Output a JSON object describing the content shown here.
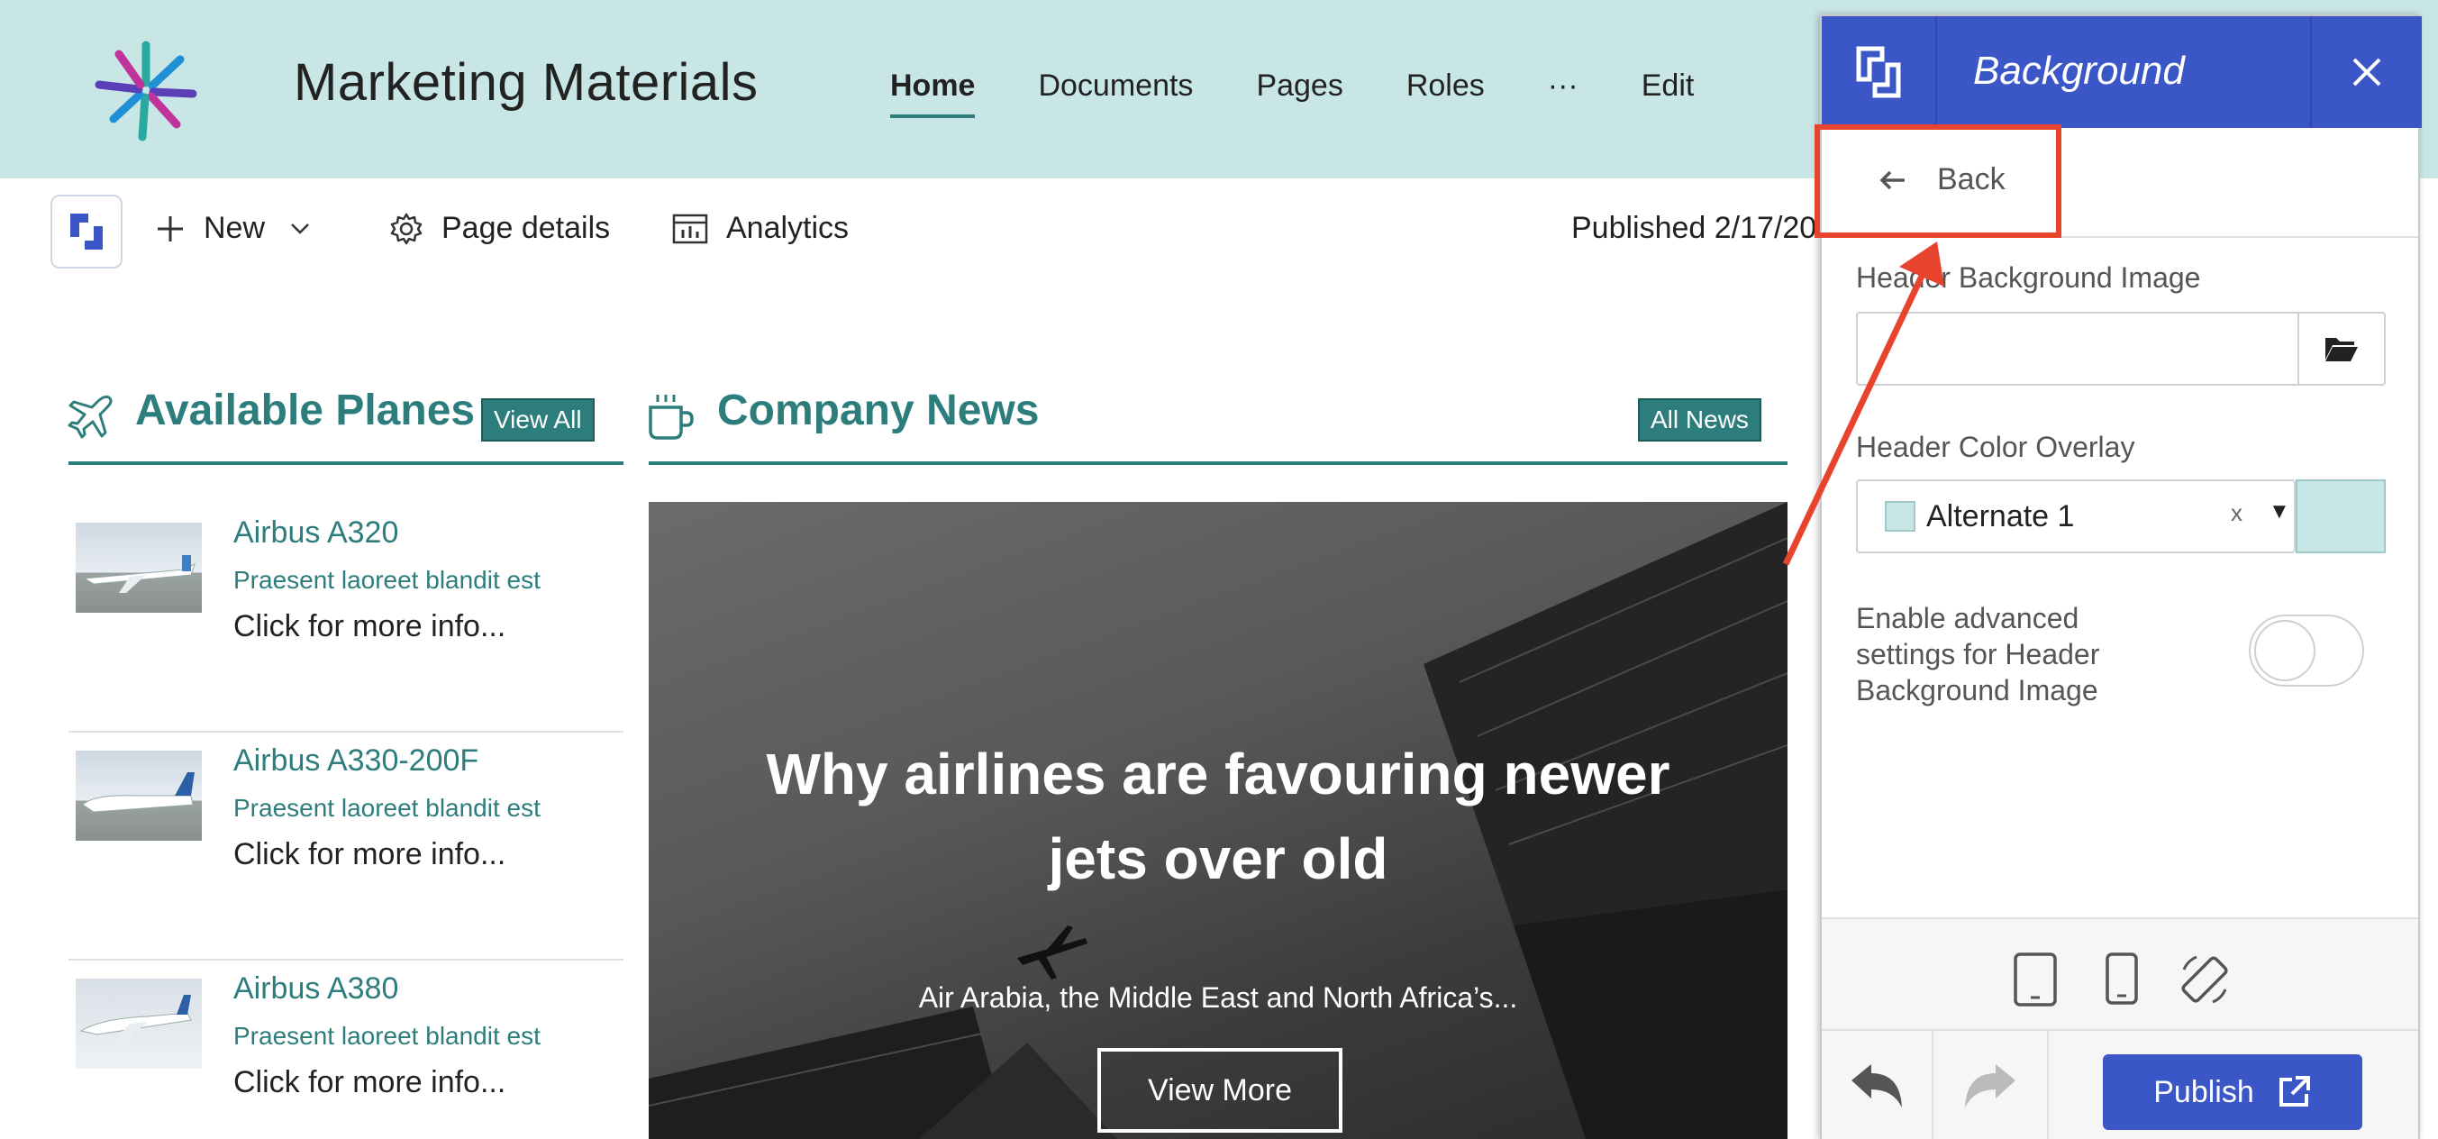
{
  "header": {
    "site_title": "Marketing Materials",
    "nav": [
      "Home",
      "Documents",
      "Pages",
      "Roles",
      "···",
      "Edit"
    ],
    "active_nav": "Home"
  },
  "command_bar": {
    "new_label": "New",
    "page_details_label": "Page details",
    "analytics_label": "Analytics",
    "published_text": "Published 2/17/20"
  },
  "planes": {
    "title": "Available Planes",
    "view_all": "View All",
    "items": [
      {
        "name": "Airbus A320",
        "subtitle": "Praesent laoreet blandit est",
        "more": "Click for more info..."
      },
      {
        "name": "Airbus A330-200F",
        "subtitle": "Praesent laoreet blandit est",
        "more": "Click for more info..."
      },
      {
        "name": "Airbus A380",
        "subtitle": "Praesent laoreet blandit est",
        "more": "Click for more info..."
      }
    ]
  },
  "news": {
    "title": "Company News",
    "all_news": "All News",
    "hero_title": "Why airlines are favouring newer jets over old",
    "hero_subtitle": "Air Arabia, the Middle East and North Africa’s...",
    "view_more": "View More"
  },
  "panel": {
    "title": "Background",
    "back_label": "Back",
    "header_bg_image_label": "Header Background Image",
    "header_bg_image_value": "",
    "header_color_overlay_label": "Header Color Overlay",
    "overlay_selected": "Alternate 1",
    "overlay_clear": "x",
    "overlay_caret": "▼",
    "advanced_label": "Enable advanced settings for Header Background Image",
    "advanced_enabled": false,
    "publish_label": "Publish"
  },
  "colors": {
    "header_bg": "#c9e6e6",
    "accent_teal": "#2e7d7d",
    "panel_blue": "#3a56c7",
    "callout_red": "#e8442d",
    "overlay_swatch": "#c9e6e6"
  },
  "icons": {
    "site_logo": "starburst-logo-icon",
    "app_logo": "bracket-logo-icon",
    "new": "plus-icon",
    "new_dropdown": "chevron-down-icon",
    "page_details": "gear-icon",
    "analytics": "analytics-icon",
    "planes": "airplane-icon",
    "news": "coffee-cup-icon",
    "close": "close-icon",
    "back": "arrow-left-icon",
    "folder": "folder-open-icon",
    "tablet": "tablet-icon",
    "phone": "phone-icon",
    "rotate": "rotate-icon",
    "undo": "undo-icon",
    "redo": "redo-icon",
    "external": "external-link-icon"
  }
}
